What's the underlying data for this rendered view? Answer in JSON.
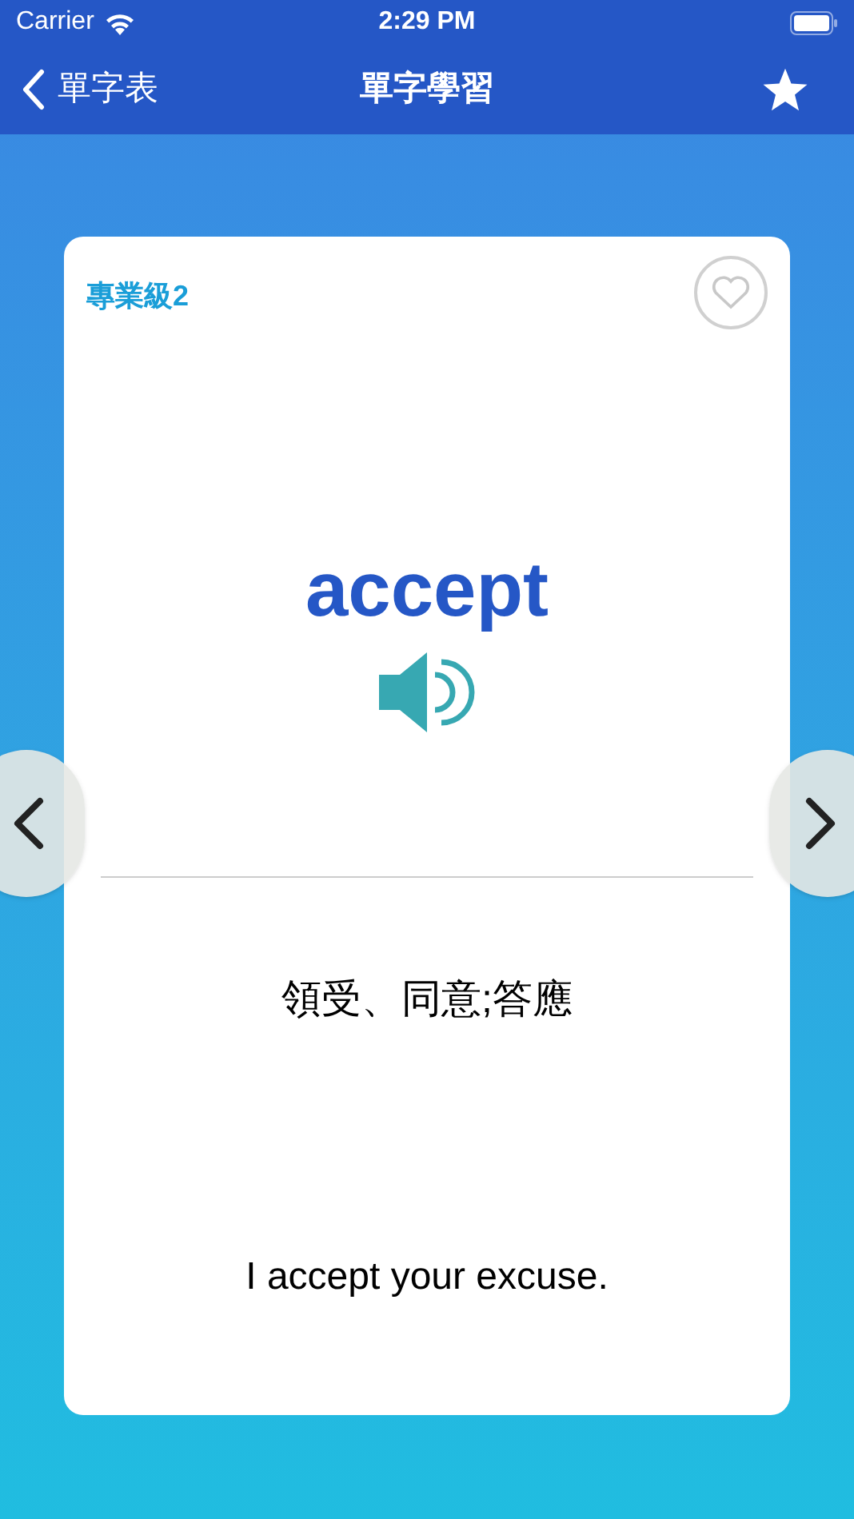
{
  "status_bar": {
    "carrier": "Carrier",
    "time": "2:29 PM"
  },
  "nav": {
    "back_label": "單字表",
    "title": "單字學習"
  },
  "card": {
    "level": "專業級2",
    "favorited": false,
    "word": "accept",
    "meaning": "領受、同意;答應",
    "example": "I accept your excuse."
  }
}
